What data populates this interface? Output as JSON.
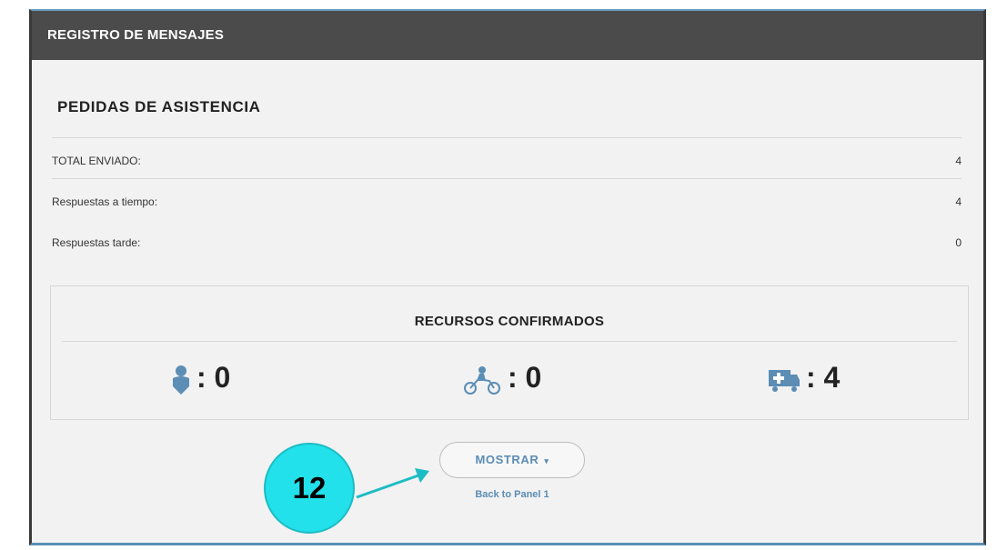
{
  "panel": {
    "title": "REGISTRO DE MENSAJES"
  },
  "assistance": {
    "title": "PEDIDAS DE ASISTENCIA",
    "rows": [
      {
        "label": "TOTAL ENVIADO:",
        "value": "4"
      },
      {
        "label": "Respuestas a tiempo:",
        "value": "4"
      },
      {
        "label": "Respuestas tarde:",
        "value": "0"
      }
    ]
  },
  "resources": {
    "title": "RECURSOS CONFIRMADOS",
    "items": [
      {
        "icon": "person-icon",
        "value": ": 0"
      },
      {
        "icon": "motorcycle-icon",
        "value": ": 0"
      },
      {
        "icon": "ambulance-icon",
        "value": ": 4"
      }
    ]
  },
  "show_button": {
    "label": "MOSTRAR",
    "caret": "▾"
  },
  "back_link": "Back to Panel 1",
  "callout": {
    "number": "12"
  },
  "colors": {
    "header": "#4b4b4b",
    "link": "#5b8db5",
    "callout": "#22e1ea"
  }
}
